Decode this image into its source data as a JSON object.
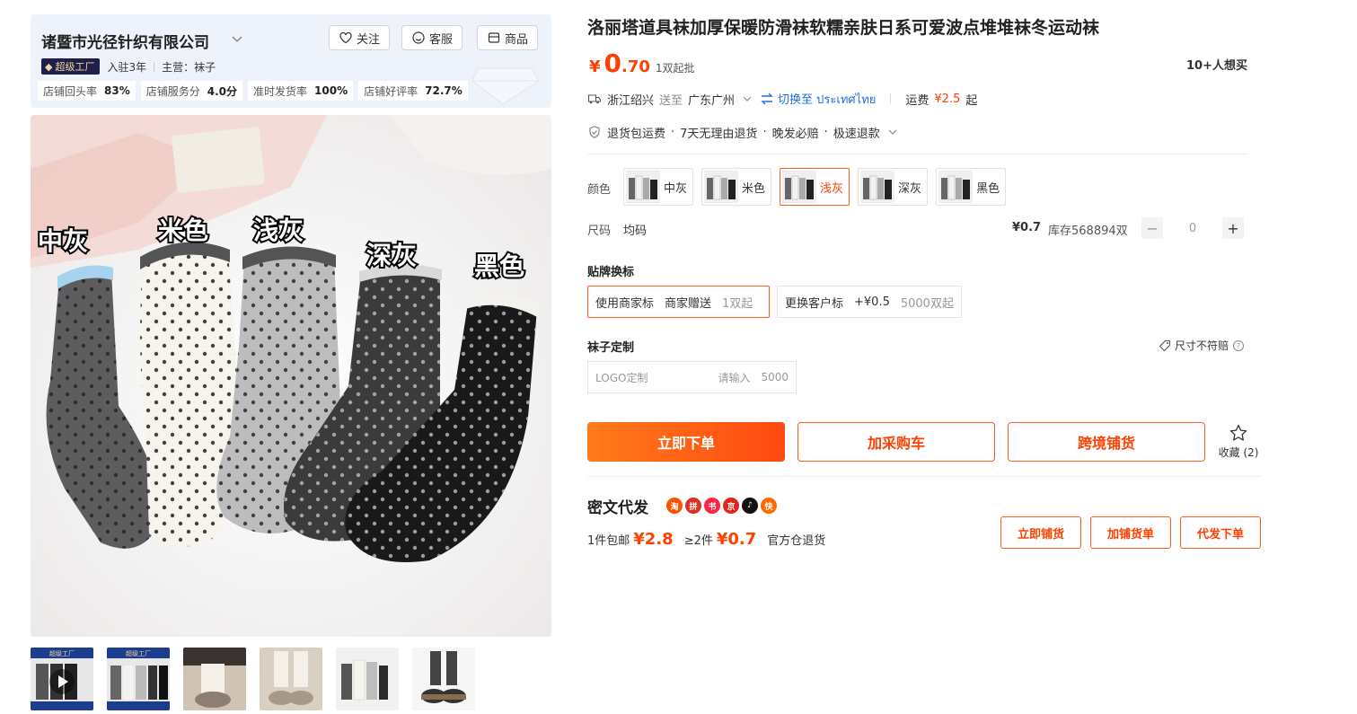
{
  "store": {
    "name": "诸暨市光径针织有限公司",
    "follow_label": "关注",
    "service_label": "客服",
    "goods_label": "商品",
    "badge": "超级工厂",
    "joined": "入驻3年",
    "main_business": "主营：袜子",
    "stats": [
      {
        "label": "店铺回头率",
        "value": "83%"
      },
      {
        "label": "店铺服务分",
        "value": "4.0分"
      },
      {
        "label": "准时发货率",
        "value": "100%"
      },
      {
        "label": "店铺好评率",
        "value": "72.7%"
      }
    ]
  },
  "photo": {
    "labels": [
      "中灰",
      "米色",
      "浅灰",
      "深灰",
      "黑色"
    ]
  },
  "thumbnails": [
    {
      "name": "thumb-video",
      "badge": "超级工厂"
    },
    {
      "name": "thumb-2",
      "badge": "超级工厂"
    },
    {
      "name": "thumb-3",
      "badge": ""
    },
    {
      "name": "thumb-4",
      "badge": ""
    },
    {
      "name": "thumb-5",
      "badge": ""
    },
    {
      "name": "thumb-6",
      "badge": ""
    }
  ],
  "product": {
    "title": "洛丽塔道具袜加厚保暖防滑袜软糯亲肤日系可爱波点堆堆袜冬运动袜",
    "price_symbol": "¥",
    "price_int": "0",
    "price_dec": ".70",
    "price_unit": "1双起批",
    "want_buy": "10+人想买"
  },
  "shipping": {
    "from": "浙江绍兴",
    "to_word": "送至",
    "to": "广东广州",
    "switch_label": "切换至 ประเทศไทย",
    "fee_label": "运费",
    "fee_value": "¥2.5",
    "fee_suffix": "起"
  },
  "services": [
    "退货包运费",
    "7天无理由退货",
    "晚发必赔",
    "极速退款"
  ],
  "variants": {
    "color_label": "颜色",
    "colors": [
      {
        "label": "中灰",
        "active": false
      },
      {
        "label": "米色",
        "active": false
      },
      {
        "label": "浅灰",
        "active": true
      },
      {
        "label": "深灰",
        "active": false
      },
      {
        "label": "黑色",
        "active": false
      }
    ],
    "size_label": "尺码",
    "size_value": "均码",
    "sku_price": "¥0.7",
    "stock": "库存568894双",
    "qty": "0",
    "minus": "−",
    "plus": "+"
  },
  "labeling": {
    "title": "贴牌换标",
    "options": [
      {
        "name": "使用商家标",
        "desc": "商家赠送",
        "min": "1双起",
        "active": true
      },
      {
        "name": "更换客户标",
        "desc": "+¥0.5",
        "min": "5000双起",
        "active": false
      }
    ]
  },
  "custom": {
    "title": "袜子定制",
    "size_note": "尺寸不符赔",
    "logo_label": "LOGO定制",
    "placeholder": "请输入",
    "qty": "5000"
  },
  "actions": {
    "buy_now": "立即下单",
    "add_cart": "加采购车",
    "cross_border": "跨境铺货",
    "favorite": "收藏 (2)"
  },
  "dropship": {
    "title": "密文代发",
    "platforms": [
      {
        "name": "taobao",
        "char": "淘",
        "color": "#ff5000"
      },
      {
        "name": "pinduoduo",
        "char": "拼",
        "color": "#e02e24"
      },
      {
        "name": "xiaohongshu",
        "char": "书",
        "color": "#ff2442"
      },
      {
        "name": "jd",
        "char": "京",
        "color": "#e1251b"
      },
      {
        "name": "douyin",
        "char": "♪",
        "color": "#111111"
      },
      {
        "name": "kuaishou",
        "char": "快",
        "color": "#ff6a00"
      }
    ],
    "price1_label": "1件包邮",
    "price1": "¥2.8",
    "price2_label": "≥2件",
    "price2": "¥0.7",
    "return_note": "官方仓退货",
    "btn_list": "立即铺货",
    "btn_add": "加铺货单",
    "btn_order": "代发下单"
  }
}
